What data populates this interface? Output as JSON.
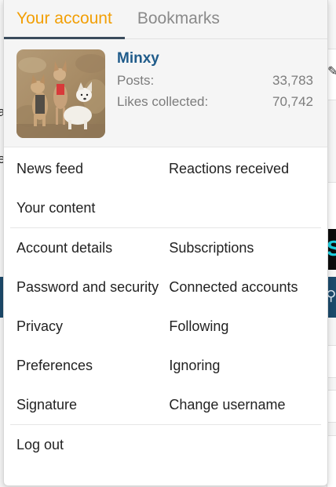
{
  "tabs": [
    {
      "label": "Your account",
      "active": true
    },
    {
      "label": "Bookmarks",
      "active": false
    }
  ],
  "profile": {
    "username": "Minxy",
    "posts_label": "Posts:",
    "posts_value": "33,783",
    "likes_label": "Likes collected:",
    "likes_value": "70,742"
  },
  "menu": {
    "section1": {
      "left": [
        "News feed",
        "Your content"
      ],
      "right": [
        "Reactions received"
      ]
    },
    "section2": {
      "left": [
        "Account details",
        "Password and security",
        "Privacy",
        "Preferences",
        "Signature"
      ],
      "right": [
        "Subscriptions",
        "Connected accounts",
        "Following",
        "Ignoring",
        "Change username"
      ]
    },
    "logout": "Log out"
  },
  "colors": {
    "active_tab": "#f29f05",
    "username": "#1f5b8a",
    "tab_underline": "#3a4b5c"
  },
  "icons": {
    "avatar": "dogs-photo-avatar",
    "edit": "edit-icon",
    "search": "search-icon"
  }
}
